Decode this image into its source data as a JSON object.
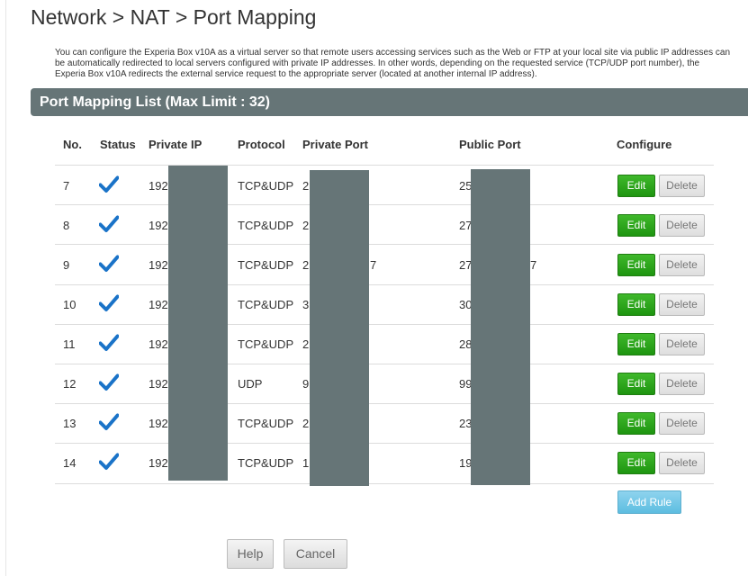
{
  "page": {
    "title": "Network > NAT > Port Mapping",
    "description": "You can configure the Experia Box v10A as a virtual server so that remote users accessing services such as the Web or FTP at your local site via public IP addresses can be automatically redirected to local servers configured with private IP addresses. In other words, depending on the requested service (TCP/UDP port number), the Experia Box v10A redirects the external service request to the appropriate server (located at another internal IP address)."
  },
  "section": {
    "title": "Port Mapping List (Max Limit : 32)"
  },
  "table": {
    "headers": {
      "no": "No.",
      "status": "Status",
      "private_ip": "Private IP",
      "protocol": "Protocol",
      "private_port": "Private Port",
      "public_port": "Public Port",
      "configure": "Configure"
    },
    "rows": [
      {
        "no": "7",
        "status": "enabled",
        "private_ip": "192",
        "protocol": "TCP&UDP",
        "private_port": "2",
        "private_port_tail": "",
        "public_port": "25",
        "public_port_tail": ""
      },
      {
        "no": "8",
        "status": "enabled",
        "private_ip": "192",
        "protocol": "TCP&UDP",
        "private_port": "2",
        "private_port_tail": "",
        "public_port": "27",
        "public_port_tail": ""
      },
      {
        "no": "9",
        "status": "enabled",
        "private_ip": "192",
        "protocol": "TCP&UDP",
        "private_port": "2",
        "private_port_tail": "7",
        "public_port": "27",
        "public_port_tail": "7"
      },
      {
        "no": "10",
        "status": "enabled",
        "private_ip": "192",
        "protocol": "TCP&UDP",
        "private_port": "3",
        "private_port_tail": "",
        "public_port": "30",
        "public_port_tail": ""
      },
      {
        "no": "11",
        "status": "enabled",
        "private_ip": "192",
        "protocol": "TCP&UDP",
        "private_port": "2",
        "private_port_tail": "",
        "public_port": "28",
        "public_port_tail": ""
      },
      {
        "no": "12",
        "status": "enabled",
        "private_ip": "192",
        "protocol": "UDP",
        "private_port": "9",
        "private_port_tail": "",
        "public_port": "99",
        "public_port_tail": ""
      },
      {
        "no": "13",
        "status": "enabled",
        "private_ip": "192",
        "protocol": "TCP&UDP",
        "private_port": "2",
        "private_port_tail": "",
        "public_port": "23",
        "public_port_tail": ""
      },
      {
        "no": "14",
        "status": "enabled",
        "private_ip": "192",
        "protocol": "TCP&UDP",
        "private_port": "1",
        "private_port_tail": "",
        "public_port": "19",
        "public_port_tail": ""
      }
    ],
    "edit_label": "Edit",
    "delete_label": "Delete"
  },
  "buttons": {
    "add_rule": "Add Rule",
    "help": "Help",
    "cancel": "Cancel"
  },
  "colors": {
    "section_bar": "#667577",
    "redaction": "#667577",
    "check": "#1a73c8",
    "edit_button": "#2aa419",
    "add_rule_button": "#6cc6e7"
  },
  "icons": {
    "status_enabled": "checkmark-icon"
  }
}
